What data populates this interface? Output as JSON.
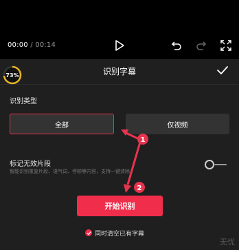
{
  "player": {
    "current_time": "00:00",
    "separator": "/",
    "total_time": "00:14"
  },
  "panel": {
    "title": "识别字幕",
    "recognition_type_label": "识别类型",
    "options": [
      {
        "label": "全部",
        "selected": true
      },
      {
        "label": "仅视频",
        "selected": false
      }
    ],
    "mark_invalid_title": "标记无效片段",
    "mark_invalid_desc": "智能识别重复片段、语气词、停顿等内容，支持一键清除",
    "mark_invalid_enabled": false,
    "start_button": "开始识别",
    "clear_existing_label": "同时清空已有字幕",
    "clear_existing_checked": true
  },
  "overlay": {
    "progress_percent": "73%",
    "step_1": "1",
    "step_2": "2",
    "watermark": "无忧"
  },
  "colors": {
    "accent": "#f02e4c",
    "panel_bg": "#1f1f1f",
    "option_bg": "#333333"
  }
}
